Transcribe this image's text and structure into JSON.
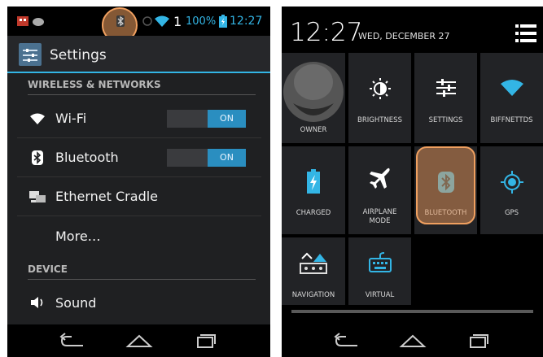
{
  "left_screen": {
    "status_bar": {
      "signal_count": "1",
      "battery_percent": "100%",
      "time": "12:27"
    },
    "action_bar": {
      "title": "Settings"
    },
    "sections": {
      "wireless": "WIRELESS & NETWORKS",
      "device": "DEVICE"
    },
    "rows": [
      {
        "label": "Wi-Fi",
        "icon": "wifi-icon",
        "toggle": "ON"
      },
      {
        "label": "Bluetooth",
        "icon": "bluetooth-icon",
        "toggle": "ON"
      },
      {
        "label": "Ethernet Cradle",
        "icon": "ethernet-icon"
      },
      {
        "label": "More…"
      },
      {
        "label": "Sound",
        "icon": "speaker-icon"
      }
    ]
  },
  "right_screen": {
    "clock": "12:27",
    "date": "WED, DECEMBER 27",
    "tiles": {
      "owner": "OWNER",
      "brightness": "BRIGHTNESS",
      "settings": "SETTINGS",
      "wifi": "BIFFNETTDS",
      "charged": "CHARGED",
      "airplane_line1": "AIRPLANE",
      "airplane_line2": "MODE",
      "bluetooth": "BLUETOOTH",
      "gps": "GPS",
      "navigation": "NAVIGATION",
      "virtual": "VIRTUAL"
    }
  },
  "colors": {
    "accent": "#33b5e5",
    "toggle_on": "#2a8ec0",
    "highlight": "#f0a060"
  }
}
